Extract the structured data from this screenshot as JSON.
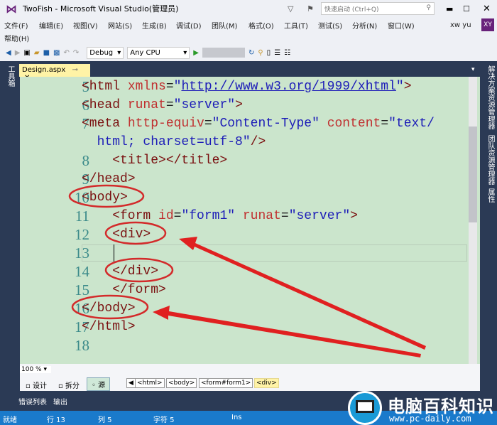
{
  "window": {
    "title": "TwoFish - Microsoft Visual Studio(管理员)",
    "quick_launch_placeholder": "快速启动 (Ctrl+Q)",
    "user": "xw yu",
    "avatar": "XY"
  },
  "menu": [
    "文件(F)",
    "编辑(E)",
    "视图(V)",
    "网站(S)",
    "生成(B)",
    "调试(D)",
    "团队(M)",
    "格式(O)",
    "工具(T)",
    "测试(S)",
    "分析(N)",
    "窗口(W)",
    "帮助(H)"
  ],
  "toolbar": {
    "config": "Debug",
    "platform": "Any CPU"
  },
  "left_panel": "工具箱",
  "right_panels": [
    "解决方案资源管理器",
    "团队资源管理器",
    "属性"
  ],
  "tab": {
    "label": "Design.aspx"
  },
  "code_lines": [
    {
      "n": "5",
      "parts": [
        [
          "t",
          "<html "
        ],
        [
          "a",
          "xmlns"
        ],
        [
          "",
          "="
        ],
        [
          "v",
          "\""
        ],
        [
          "u",
          "http://www.w3.org/1999/xhtml"
        ],
        [
          "v",
          "\""
        ],
        [
          "t",
          ">"
        ]
      ]
    },
    {
      "n": "6",
      "parts": [
        [
          "t",
          "<head "
        ],
        [
          "a",
          "runat"
        ],
        [
          "",
          "="
        ],
        [
          "v",
          "\"server\""
        ],
        [
          "t",
          ">"
        ]
      ]
    },
    {
      "n": "7",
      "parts": [
        [
          "t",
          "<meta "
        ],
        [
          "a",
          "http-equiv"
        ],
        [
          "",
          "="
        ],
        [
          "v",
          "\"Content-Type\" "
        ],
        [
          "a",
          "content"
        ],
        [
          "",
          "="
        ],
        [
          "v",
          "\"text/"
        ]
      ]
    },
    {
      "n": "",
      "parts": [
        [
          "v",
          "  html; charset=utf-8\""
        ],
        [
          "t",
          "/>"
        ]
      ]
    },
    {
      "n": "8",
      "parts": [
        [
          "t",
          "    <title></title>"
        ]
      ]
    },
    {
      "n": "9",
      "parts": [
        [
          "t",
          "</head>"
        ]
      ]
    },
    {
      "n": "10",
      "parts": [
        [
          "t",
          "<body>"
        ]
      ]
    },
    {
      "n": "11",
      "parts": [
        [
          "t",
          "    <form "
        ],
        [
          "a",
          "id"
        ],
        [
          "",
          "="
        ],
        [
          "v",
          "\"form1\" "
        ],
        [
          "a",
          "runat"
        ],
        [
          "",
          "="
        ],
        [
          "v",
          "\"server\""
        ],
        [
          "t",
          ">"
        ]
      ]
    },
    {
      "n": "12",
      "parts": [
        [
          "t",
          "    <div>"
        ]
      ]
    },
    {
      "n": "13",
      "parts": [
        [
          "",
          ""
        ]
      ]
    },
    {
      "n": "14",
      "parts": [
        [
          "t",
          "    </div>"
        ]
      ]
    },
    {
      "n": "15",
      "parts": [
        [
          "t",
          "    </form>"
        ]
      ]
    },
    {
      "n": "16",
      "parts": [
        [
          "t",
          "</body>"
        ]
      ]
    },
    {
      "n": "17",
      "parts": [
        [
          "t",
          "</html>"
        ]
      ]
    },
    {
      "n": "18",
      "parts": [
        [
          "",
          ""
        ]
      ]
    }
  ],
  "zoom": "100 %",
  "view_tabs": [
    "设计",
    "拆分",
    "源"
  ],
  "breadcrumbs": [
    "<html>",
    "<body>",
    "<form#form1>",
    "<div>"
  ],
  "panel_tabs": [
    "错误列表",
    "输出"
  ],
  "status": {
    "ready": "就绪",
    "line": "行 13",
    "col": "列 5",
    "char": "字符 5",
    "mode": "Ins"
  },
  "watermark": {
    "title": "电脑百科知识",
    "url": "www.pc-daily.com"
  },
  "colors": {
    "accent": "#1a7acb",
    "editor_bg": "#cbe5cc",
    "annotation": "#e02020"
  }
}
